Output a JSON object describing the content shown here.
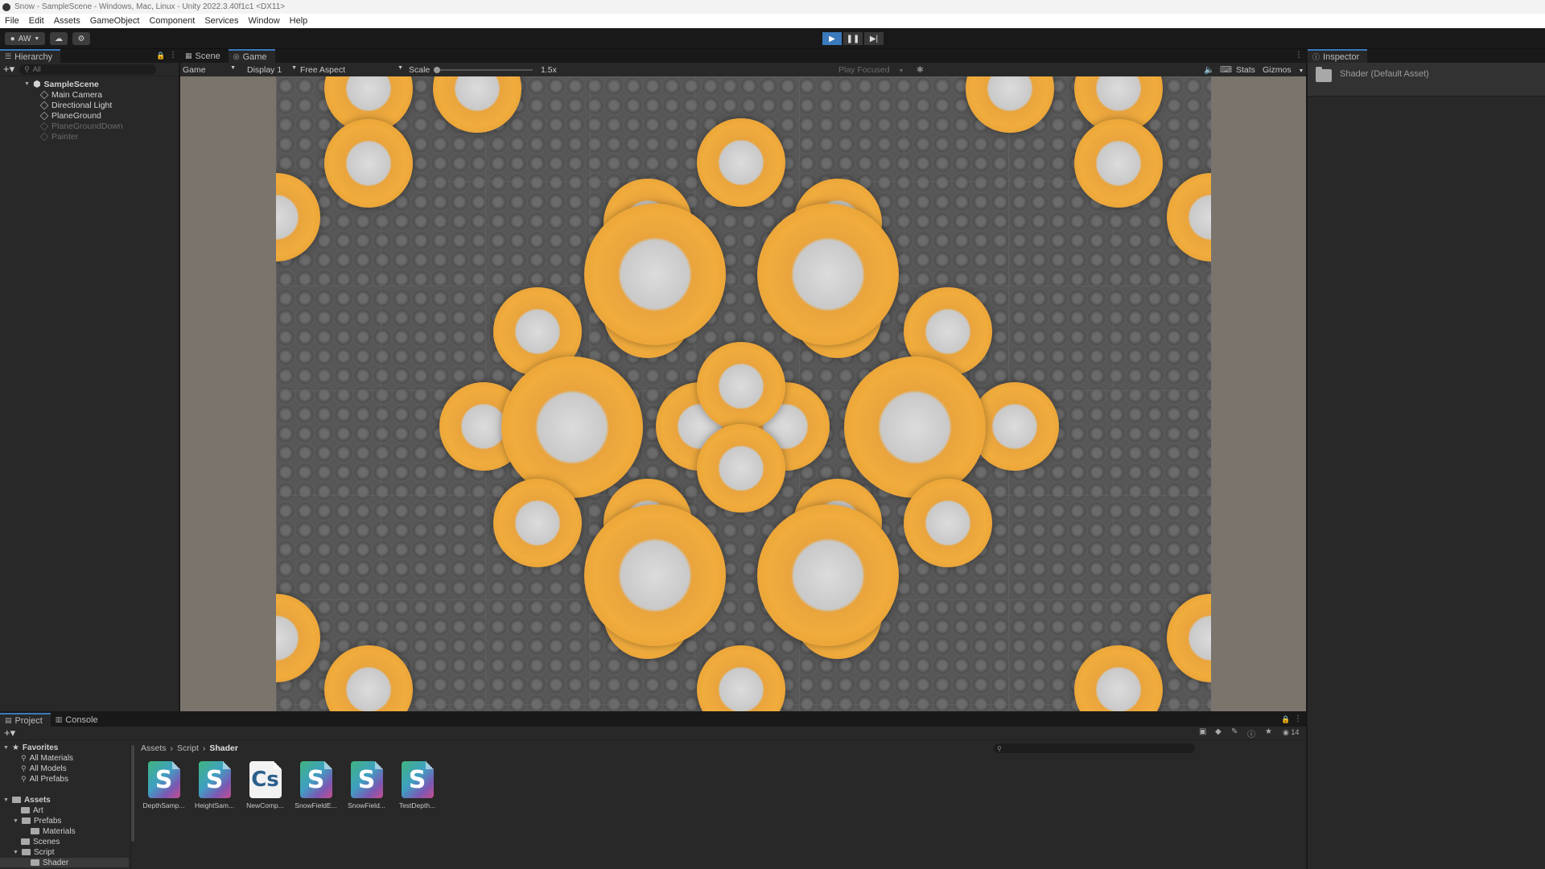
{
  "window": {
    "title": "Snow - SampleScene - Windows, Mac, Linux - Unity 2022.3.40f1c1 <DX11>"
  },
  "menu": [
    "File",
    "Edit",
    "Assets",
    "GameObject",
    "Component",
    "Services",
    "Window",
    "Help"
  ],
  "toolbar": {
    "account": "AW",
    "play_icon": "play-icon",
    "pause_icon": "pause-icon",
    "step_icon": "step-icon",
    "accent": "#3a79bb"
  },
  "hierarchy": {
    "tab_label": "Hierarchy",
    "search_placeholder": "All",
    "scene": "SampleScene",
    "items": [
      {
        "label": "Main Camera",
        "enabled": true
      },
      {
        "label": "Directional Light",
        "enabled": true
      },
      {
        "label": "PlaneGround",
        "enabled": true
      },
      {
        "label": "PlaneGroundDown",
        "enabled": false
      },
      {
        "label": "Painter",
        "enabled": false
      }
    ]
  },
  "scene_tabs": {
    "scene": "Scene",
    "game": "Game"
  },
  "game_toolbar": {
    "mode": "Game",
    "display": "Display 1",
    "aspect": "Free Aspect",
    "scale_label": "Scale",
    "scale_value": "1.5x",
    "play_focused": "Play Focused",
    "stats": "Stats",
    "gizmos": "Gizmos"
  },
  "inspector": {
    "tab_label": "Inspector",
    "asset_title": "Shader (Default Asset)"
  },
  "project": {
    "tabs": [
      "Project",
      "Console"
    ],
    "favorites_label": "Favorites",
    "favorites": [
      "All Materials",
      "All Models",
      "All Prefabs"
    ],
    "assets_label": "Assets",
    "tree": [
      "Art",
      "Prefabs",
      "Materials",
      "Scenes",
      "Script",
      "Shader"
    ],
    "breadcrumb": [
      "Assets",
      "Script",
      "Shader"
    ],
    "files": [
      {
        "name": "DepthSamp...",
        "type": "S"
      },
      {
        "name": "HeightSam...",
        "type": "S"
      },
      {
        "name": "NewComp...",
        "type": "Cs"
      },
      {
        "name": "SnowFieldE...",
        "type": "S"
      },
      {
        "name": "SnowField...",
        "type": "S"
      },
      {
        "name": "TestDepth...",
        "type": "S"
      }
    ],
    "hidden_count": "14"
  }
}
